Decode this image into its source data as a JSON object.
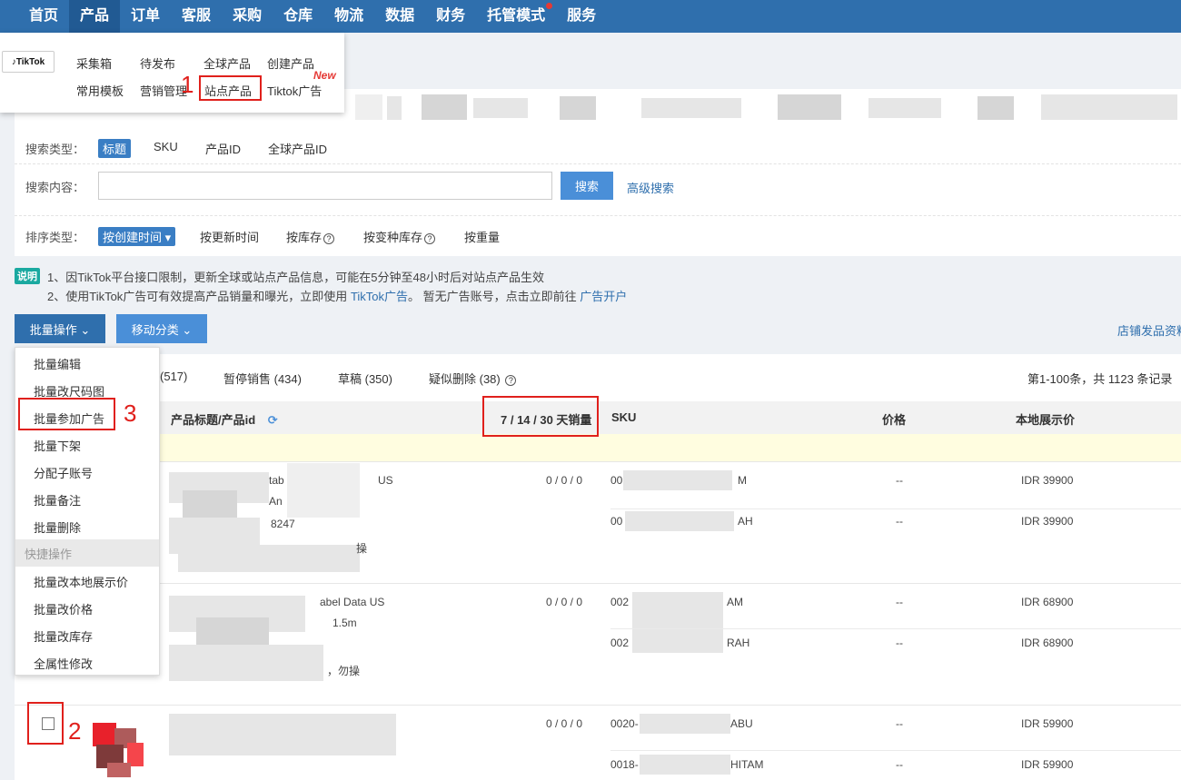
{
  "nav": {
    "items": [
      {
        "label": "首页"
      },
      {
        "label": "产品",
        "active": true
      },
      {
        "label": "订单"
      },
      {
        "label": "客服"
      },
      {
        "label": "采购"
      },
      {
        "label": "仓库"
      },
      {
        "label": "物流"
      },
      {
        "label": "数据"
      },
      {
        "label": "财务"
      },
      {
        "label": "托管模式",
        "dot": true
      },
      {
        "label": "服务"
      }
    ]
  },
  "product_menu": {
    "logo_text": "TikTok",
    "collect_box": "采集箱",
    "to_publish": "待发布",
    "global_products": "全球产品",
    "create_product": "创建产品",
    "common_template": "常用模板",
    "marketing": "营销管理",
    "site_products": "站点产品",
    "tiktok_ads": "Tiktok广告",
    "new_tag": "New"
  },
  "search": {
    "type_label": "搜索类型：",
    "types": [
      "标题",
      "SKU",
      "产品ID",
      "全球产品ID"
    ],
    "content_label": "搜索内容：",
    "button": "搜索",
    "advanced": "高级搜索",
    "sort_label": "排序类型：",
    "sort_active": "按创建时间",
    "sorts": [
      "按更新时间",
      "按库存",
      "按变种库存",
      "按重量"
    ]
  },
  "notes": {
    "badge": "说明",
    "line1": "1、因TikTok平台接口限制，更新全球或站点产品信息，可能在5分钟至48小时后对站点产品生效",
    "line2_prefix": "2、使用TikTok广告可有效提高产品销量和曝光，立即使用",
    "line2_link": "TikTok广告",
    "line2_mid": "。 暂无广告账号，点击立即前往",
    "line2_link2": "广告开户"
  },
  "actions": {
    "batch": "批量操作",
    "move": "移动分类",
    "store_link": "店铺发品资料"
  },
  "tabs": {
    "t1": "(517)",
    "t2": "暂停销售 (434)",
    "t3": "草稿 (350)",
    "t4": "疑似删除 (38)",
    "count": "第1-100条，共 1123 条记录"
  },
  "table": {
    "col_title": "产品标题/产品id",
    "col_sales": "7 / 14 / 30 天销量",
    "col_sku": "SKU",
    "col_price": "价格",
    "col_local": "本地展示价",
    "rows": [
      {
        "title_frag1": "tab",
        "title_frag2": "US",
        "title_frag3": "An",
        "id_frag": "8247",
        "tail": "操",
        "sales": "0 / 0 / 0",
        "skus": [
          {
            "a": "00",
            "b": "M",
            "price": "--",
            "local": "IDR 39900"
          },
          {
            "a": "00",
            "b": "AH",
            "price": "--",
            "local": "IDR 39900"
          }
        ]
      },
      {
        "title_frag1": "abel Data US",
        "title_frag2": "1.5m",
        "tail": "，勿操",
        "sales": "0 / 0 / 0",
        "skus": [
          {
            "a": "002",
            "b": "AM",
            "price": "--",
            "local": "IDR 68900"
          },
          {
            "a": "002",
            "b": "RAH",
            "price": "--",
            "local": "IDR 68900"
          }
        ]
      },
      {
        "sales": "0 / 0 / 0",
        "skus": [
          {
            "a": "0020-",
            "b": "ABU",
            "price": "--",
            "local": "IDR 59900"
          },
          {
            "a": "0018-",
            "b": "HITAM",
            "price": "--",
            "local": "IDR 59900"
          }
        ]
      }
    ]
  },
  "batch_menu": {
    "items": [
      "批量编辑",
      "批量改尺码图",
      "批量参加广告",
      "批量下架",
      "分配子账号",
      "批量备注",
      "批量删除"
    ],
    "quick_label": "快捷操作",
    "quick_items": [
      "批量改本地展示价",
      "批量改价格",
      "批量改库存",
      "全属性修改"
    ]
  },
  "annotations": {
    "n1": "1",
    "n2": "2",
    "n3": "3"
  },
  "colors": {
    "nav": "#2f6fad",
    "highlight": "#e0201c",
    "accent": "#4a8fd8"
  }
}
